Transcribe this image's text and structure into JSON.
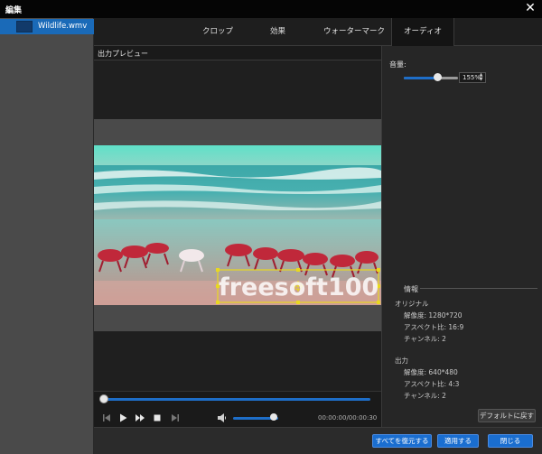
{
  "window": {
    "title": "編集",
    "close_glyph": "✕"
  },
  "file_list": {
    "items": [
      {
        "name": "Wildlife.wmv"
      }
    ]
  },
  "tabs": [
    {
      "label": "クロップ"
    },
    {
      "label": "効果"
    },
    {
      "label": "ウォーターマーク"
    },
    {
      "label": "オーディオ",
      "active": true
    }
  ],
  "preview": {
    "label": "出力プレビュー",
    "watermark_text": "freesoft100",
    "seek_progress": 0.0
  },
  "playback": {
    "time": "00:00:00/00:00:30",
    "volume_level": 0.9
  },
  "audio": {
    "volume_label": "音量:",
    "volume_value": "155%",
    "slider_level": 0.62
  },
  "info": {
    "title": "情報",
    "original": {
      "heading": "オリジナル",
      "resolution": "解像度: 1280*720",
      "aspect": "アスペクト比: 16:9",
      "channel": "チャンネル: 2"
    },
    "output": {
      "heading": "出力",
      "resolution": "解像度: 640*480",
      "aspect": "アスペクト比: 4:3",
      "channel": "チャンネル: 2"
    }
  },
  "buttons": {
    "default": "デフォルトに戻す",
    "restore_all": "すべてを復元する",
    "apply": "適用する",
    "close": "閉じる"
  },
  "colors": {
    "accent": "#1a6ed0",
    "selected_item": "#1a6ab8",
    "watermark_box": "#e8d820"
  },
  "icons": [
    "close-icon",
    "video-thumb-icon",
    "seek-start-icon",
    "play-icon",
    "fast-forward-icon",
    "stop-icon",
    "seek-end-icon",
    "volume-icon",
    "spin-arrows-icon"
  ]
}
